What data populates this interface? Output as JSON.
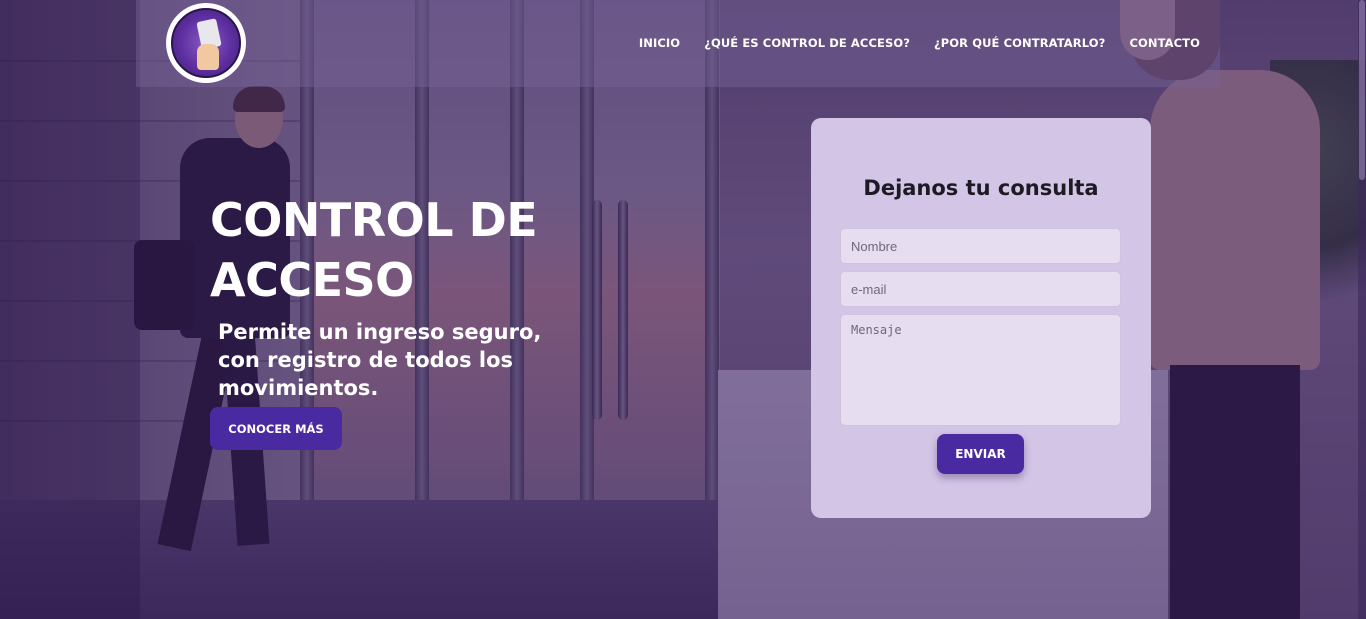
{
  "brand": {
    "logo_icon": "access-card-hand-icon"
  },
  "nav": {
    "items": [
      {
        "label": "INICIO"
      },
      {
        "label": "¿QUÉ ES CONTROL DE ACCESO?"
      },
      {
        "label": "¿POR QUÉ CONTRATARLO?"
      },
      {
        "label": "CONTACTO"
      }
    ]
  },
  "hero": {
    "title_line1": "CONTROL DE",
    "title_line2": "ACCESO",
    "subtitle": "Permite un ingreso seguro, con registro de todos los movimientos.",
    "cta_label": "CONOCER MÁS"
  },
  "contact_form": {
    "title": "Dejanos tu consulta",
    "name_placeholder": "Nombre",
    "email_placeholder": "e-mail",
    "message_placeholder": "Mensaje",
    "submit_label": "ENVIAR"
  },
  "colors": {
    "accent": "#4a2aa0",
    "overlay": "#3a1e64",
    "form_background": "#d3c5e6"
  }
}
